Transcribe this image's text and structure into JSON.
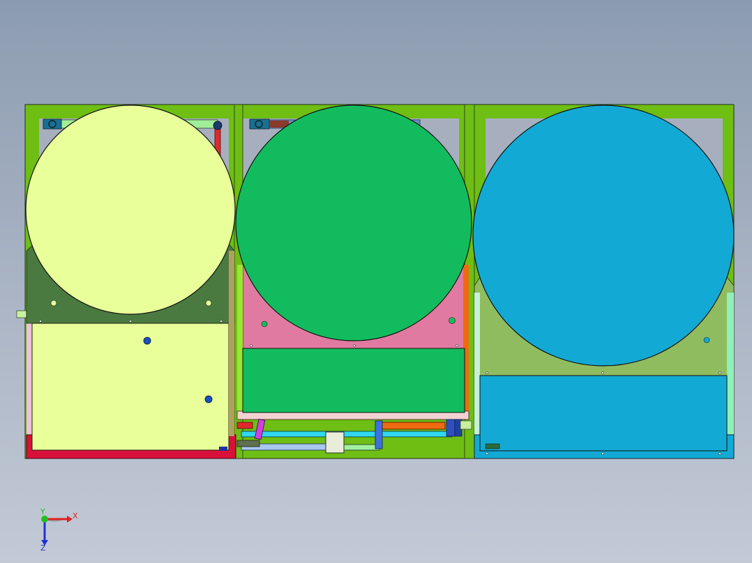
{
  "view": {
    "background_top": "#8c9cb0",
    "background_bottom": "#c3cad6"
  },
  "triad": {
    "x_label": "X",
    "y_label": "Y",
    "z_label": "Z",
    "x_color": "#e02020",
    "y_color": "#20c020",
    "z_color": "#2030d0"
  },
  "assembly": {
    "frame_color": "#6ebe14",
    "units": [
      {
        "name": "left-unit",
        "tank_color": "#e8ff9a",
        "panel_color": "#4a7a40",
        "base_color": "#d8103a"
      },
      {
        "name": "middle-unit",
        "tank_color": "#12bc5e",
        "panel_color": "#e07aa0",
        "base_color": "#f2d2d2"
      },
      {
        "name": "right-unit",
        "tank_color": "#12aad4",
        "panel_color": "#90bc60",
        "base_color": "#12aad4"
      }
    ]
  }
}
